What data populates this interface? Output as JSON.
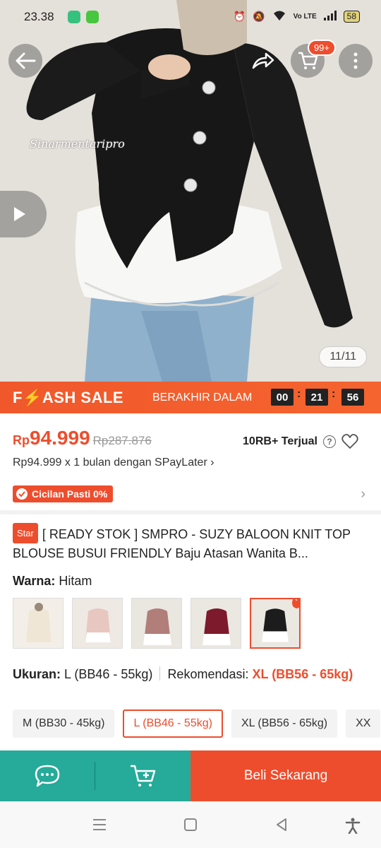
{
  "status_bar": {
    "time": "23.38",
    "battery": "58",
    "network": "Vo LTE"
  },
  "gallery": {
    "watermark": "Sinarmentaripro",
    "counter": "11/11",
    "cart_badge": "99+"
  },
  "flash_sale": {
    "logo": "F⚡ASH SALE",
    "ends_label": "BERAKHIR DALAM",
    "hours": "00",
    "minutes": "21",
    "seconds": "56"
  },
  "price": {
    "currency": "Rp",
    "current": "94.999",
    "original": "Rp287.876",
    "sold": "10RB+ Terjual",
    "installment": "Rp94.999 x 1 bulan dengan SPayLater ›",
    "cicilan": "Cicilan Pasti 0%"
  },
  "product": {
    "badge": "Star",
    "title": "[ READY STOK ] SMPRO - SUZY BALOON KNIT TOP BLOUSE BUSUI FRIENDLY Baju Atasan Wanita B..."
  },
  "variant": {
    "color_label": "Warna:",
    "color_value": "Hitam",
    "swatch_colors": [
      "#efe6d6",
      "#e8c7c0",
      "#b27e7a",
      "#7d1a2c",
      "#1c1c1c"
    ],
    "size_label": "Ukuran:",
    "size_value": "L (BB46 - 55kg)",
    "rec_label": "Rekomendasi:",
    "rec_value": "XL (BB56 - 65kg)",
    "sizes": [
      "M (BB30 - 45kg)",
      "L (BB46 - 55kg)",
      "XL (BB56 - 65kg)",
      "XX"
    ]
  },
  "actions": {
    "buy": "Beli Sekarang"
  },
  "colors": {
    "accent": "#ee4d2d",
    "teal": "#26aa99"
  }
}
